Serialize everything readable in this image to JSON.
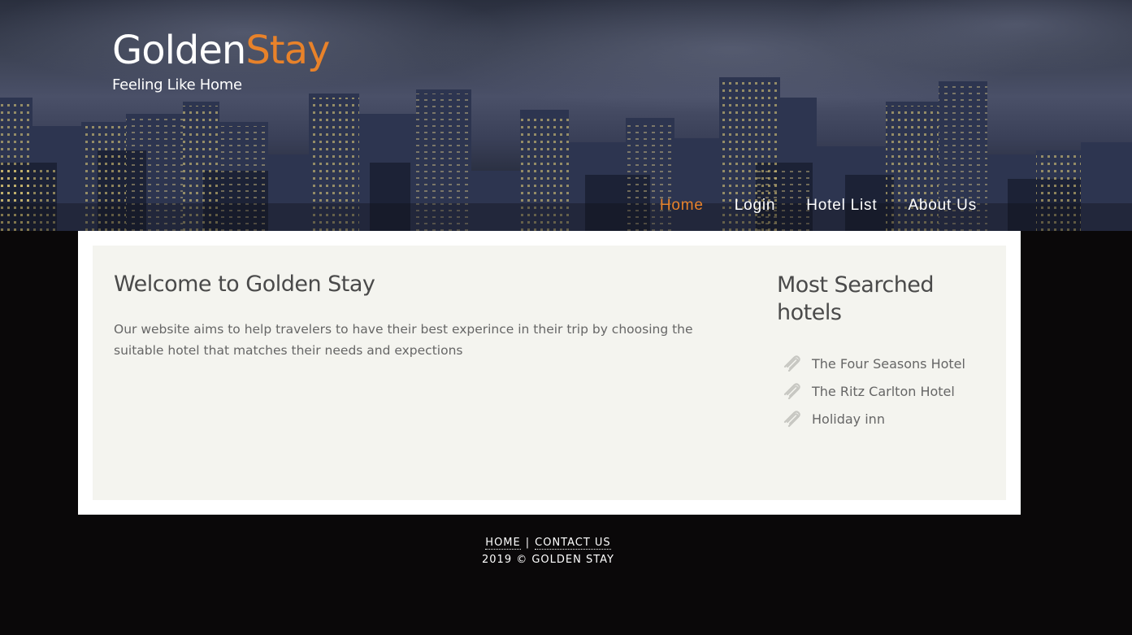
{
  "header": {
    "logo_part1": "Golden",
    "logo_part2": "Stay",
    "tagline": "Feeling Like Home",
    "accent_color": "#e8822a"
  },
  "nav": {
    "items": [
      {
        "label": "Home",
        "active": true
      },
      {
        "label": "Login",
        "active": false
      },
      {
        "label": "Hotel List",
        "active": false
      },
      {
        "label": "About Us",
        "active": false
      }
    ]
  },
  "main": {
    "title": "Welcome to Golden Stay",
    "text": "Our website aims to help travelers to have their best experince in their trip by choosing the suitable hotel that matches their needs and expections"
  },
  "sidebar": {
    "title": "Most Searched hotels",
    "icon": "paperclip-icon",
    "items": [
      {
        "label": "The Four Seasons Hotel"
      },
      {
        "label": "The Ritz Carlton Hotel"
      },
      {
        "label": "Holiday inn"
      }
    ]
  },
  "footer": {
    "home_link": "HOME",
    "separator": "|",
    "contact_link": "CONTACT US",
    "copyright": "2019 © GOLDEN STAY"
  }
}
